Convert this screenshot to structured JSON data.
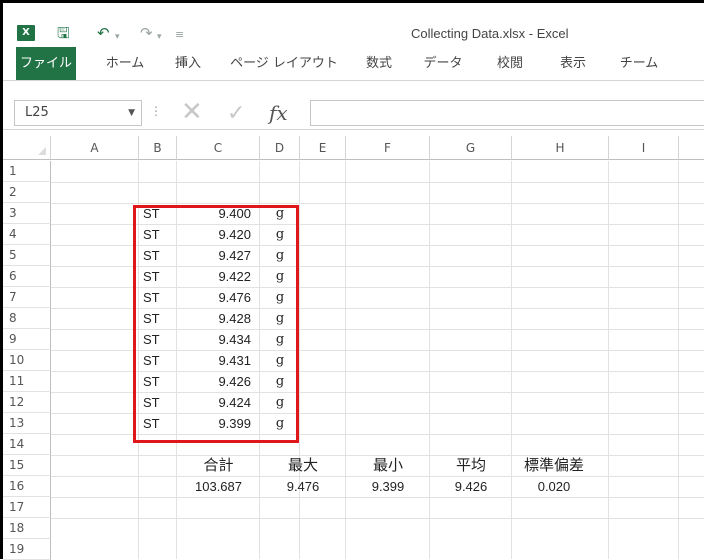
{
  "window": {
    "title": "Collecting Data.xlsx - Excel",
    "app_badge": "X"
  },
  "qat": {
    "save_icon": "save-icon",
    "undo_icon": "undo-icon",
    "redo_icon": "redo-icon",
    "customize_icon": "customize-icon"
  },
  "ribbon": {
    "tabs": [
      "ファイル",
      "ホーム",
      "挿入",
      "ページ レイアウト",
      "数式",
      "データ",
      "校閲",
      "表示",
      "チーム"
    ]
  },
  "formula_bar": {
    "name_box": "L25",
    "fx_label": "fx",
    "formula": ""
  },
  "sheet": {
    "columns": [
      "A",
      "B",
      "C",
      "D",
      "E",
      "F",
      "G",
      "H",
      "I"
    ],
    "rows": [
      "1",
      "2",
      "3",
      "4",
      "5",
      "6",
      "7",
      "8",
      "9",
      "10",
      "11",
      "12",
      "13",
      "14",
      "15",
      "16",
      "17",
      "18",
      "19"
    ],
    "measurements": [
      {
        "label": "ST",
        "value": "9.400",
        "unit": "g"
      },
      {
        "label": "ST",
        "value": "9.420",
        "unit": "g"
      },
      {
        "label": "ST",
        "value": "9.427",
        "unit": "g"
      },
      {
        "label": "ST",
        "value": "9.422",
        "unit": "g"
      },
      {
        "label": "ST",
        "value": "9.476",
        "unit": "g"
      },
      {
        "label": "ST",
        "value": "9.428",
        "unit": "g"
      },
      {
        "label": "ST",
        "value": "9.434",
        "unit": "g"
      },
      {
        "label": "ST",
        "value": "9.431",
        "unit": "g"
      },
      {
        "label": "ST",
        "value": "9.426",
        "unit": "g"
      },
      {
        "label": "ST",
        "value": "9.424",
        "unit": "g"
      },
      {
        "label": "ST",
        "value": "9.399",
        "unit": "g"
      }
    ],
    "summary_headers": {
      "total": "合計",
      "max": "最大",
      "min": "最小",
      "avg": "平均",
      "stdev": "標準偏差"
    },
    "summary_values": {
      "total": "103.687",
      "max": "9.476",
      "min": "9.399",
      "avg": "9.426",
      "stdev": "0.020"
    },
    "highlight_color": "#e0161a"
  },
  "colors": {
    "excel_green": "#217346"
  }
}
